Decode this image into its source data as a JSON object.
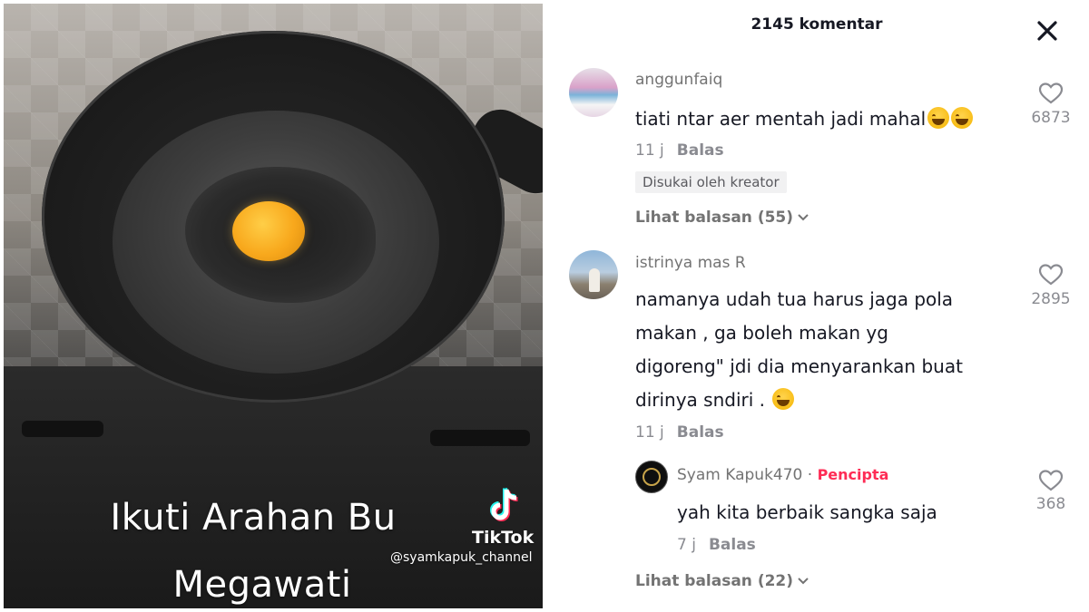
{
  "video": {
    "caption_line1": "Ikuti Arahan Bu",
    "caption_line2": "Megawati",
    "brand": "TikTok",
    "handle": "@syamkapuk_channel"
  },
  "panel": {
    "count_title": "2145 komentar",
    "close_icon": "close-icon"
  },
  "comments": [
    {
      "username": "anggunfaiq",
      "text": "tiati ntar aer mentah jadi mahal",
      "emojis": 2,
      "time": "11 j",
      "reply_label": "Balas",
      "badge": "Disukai oleh kreator",
      "likes": "6873",
      "view_replies": "Lihat balasan (55)"
    },
    {
      "username": "istrinya mas R",
      "text_lines": [
        "namanya udah tua harus jaga pola",
        "makan , ga boleh makan yg",
        "digoreng\" jdi dia menyarankan buat",
        "dirinya sndiri ."
      ],
      "emojis": 1,
      "time": "11 j",
      "reply_label": "Balas",
      "likes": "2895",
      "view_replies": "Lihat balasan (22)"
    }
  ],
  "reply": {
    "username": "Syam Kapuk470",
    "separator": "·",
    "creator_label": "Pencipta",
    "text": "yah kita berbaik sangka saja",
    "time": "7 j",
    "reply_label": "Balas",
    "likes": "368"
  },
  "colors": {
    "accent_creator": "#fe2c55",
    "text_primary": "#161823",
    "text_secondary": "#8a8b91"
  }
}
